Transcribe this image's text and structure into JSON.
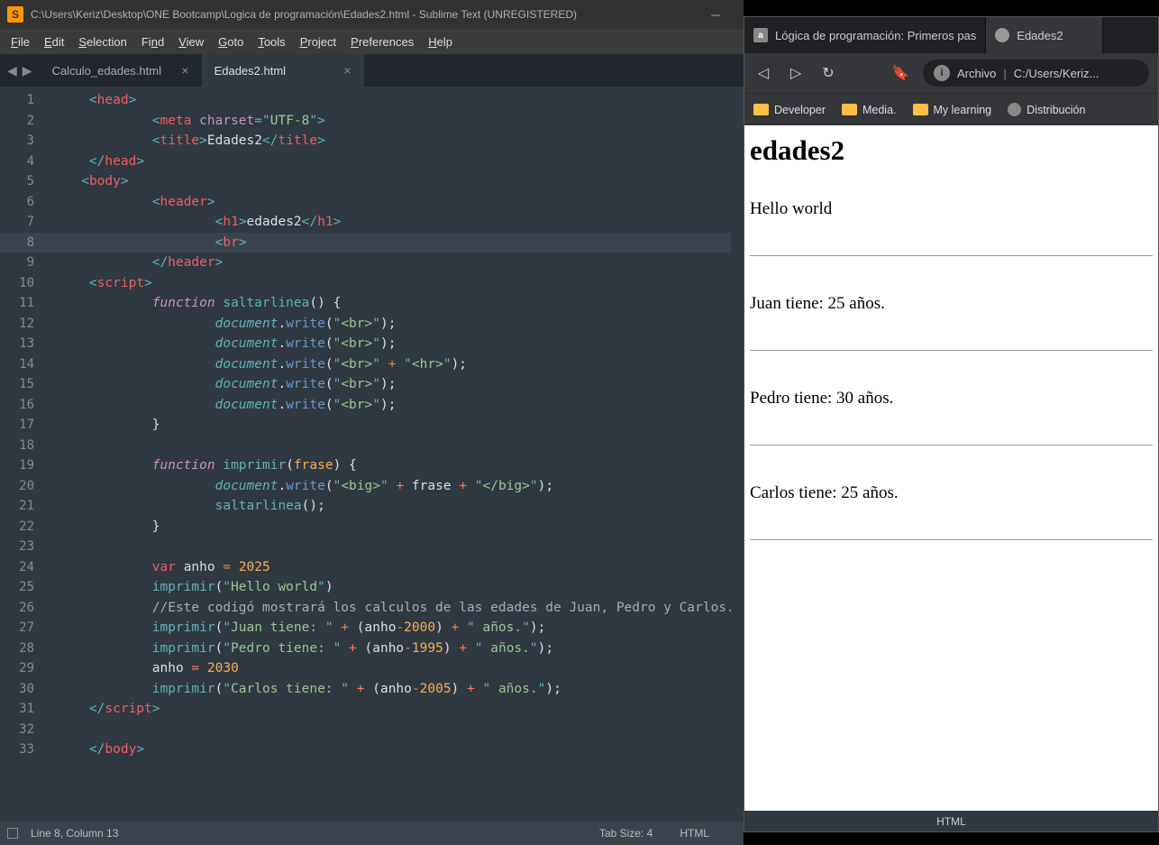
{
  "sublime": {
    "title": "C:\\Users\\Keriz\\Desktop\\ONE Bootcamp\\Logica de programación\\Edades2.html - Sublime Text (UNREGISTERED)",
    "menu": [
      "File",
      "Edit",
      "Selection",
      "Find",
      "View",
      "Goto",
      "Tools",
      "Project",
      "Preferences",
      "Help"
    ],
    "tabs": [
      {
        "label": "Calculo_edades.html",
        "active": false
      },
      {
        "label": "Edades2.html",
        "active": true
      }
    ],
    "status_left": "Line 8, Column 13",
    "status_tab": "Tab Size: 4",
    "status_lang": "HTML",
    "code": {
      "l1": {
        "i": 0,
        "tokens": [
          {
            "c": "p",
            "t": "<"
          },
          {
            "c": "tag",
            "t": "head"
          },
          {
            "c": "p",
            "t": ">"
          }
        ]
      },
      "l2": {
        "i": 2,
        "tokens": [
          {
            "c": "p",
            "t": "<"
          },
          {
            "c": "tag",
            "t": "meta"
          },
          {
            "c": "txt",
            "t": " "
          },
          {
            "c": "attr",
            "t": "charset"
          },
          {
            "c": "p",
            "t": "="
          },
          {
            "c": "p",
            "t": "\""
          },
          {
            "c": "str",
            "t": "UTF-8"
          },
          {
            "c": "p",
            "t": "\""
          },
          {
            "c": "p",
            "t": ">"
          }
        ]
      },
      "l3": {
        "i": 2,
        "tokens": [
          {
            "c": "p",
            "t": "<"
          },
          {
            "c": "tag",
            "t": "title"
          },
          {
            "c": "p",
            "t": ">"
          },
          {
            "c": "txt",
            "t": "Edades2"
          },
          {
            "c": "p",
            "t": "</"
          },
          {
            "c": "tag",
            "t": "title"
          },
          {
            "c": "p",
            "t": ">"
          }
        ]
      },
      "l4": {
        "i": 0,
        "tokens": [
          {
            "c": "p",
            "t": "</"
          },
          {
            "c": "tag",
            "t": "head"
          },
          {
            "c": "p",
            "t": ">"
          }
        ]
      },
      "l5": {
        "i": -1,
        "tokens": [
          {
            "c": "p",
            "t": "<"
          },
          {
            "c": "tag",
            "t": "body"
          },
          {
            "c": "p",
            "t": ">"
          }
        ]
      },
      "l6": {
        "i": 2,
        "tokens": [
          {
            "c": "p",
            "t": "<"
          },
          {
            "c": "tag",
            "t": "header"
          },
          {
            "c": "p",
            "t": ">"
          }
        ]
      },
      "l7": {
        "i": 4,
        "tokens": [
          {
            "c": "p",
            "t": "<"
          },
          {
            "c": "tag",
            "t": "h1"
          },
          {
            "c": "p",
            "t": ">"
          },
          {
            "c": "txt",
            "t": "edades2"
          },
          {
            "c": "p",
            "t": "</"
          },
          {
            "c": "tag",
            "t": "h1"
          },
          {
            "c": "p",
            "t": ">"
          }
        ]
      },
      "l8": {
        "i": 4,
        "tokens": [
          {
            "c": "p",
            "t": "<"
          },
          {
            "c": "tag",
            "t": "br"
          },
          {
            "c": "p",
            "t": ">"
          }
        ],
        "hl": true
      },
      "l9": {
        "i": 2,
        "tokens": [
          {
            "c": "p",
            "t": "</"
          },
          {
            "c": "tag",
            "t": "header"
          },
          {
            "c": "p",
            "t": ">"
          }
        ]
      },
      "l10": {
        "i": 0,
        "tokens": [
          {
            "c": "p",
            "t": "<"
          },
          {
            "c": "tag",
            "t": "script"
          },
          {
            "c": "p",
            "t": ">"
          }
        ]
      },
      "l11": {
        "i": 2,
        "tokens": [
          {
            "c": "kw",
            "t": "function"
          },
          {
            "c": "txt",
            "t": " "
          },
          {
            "c": "fn",
            "t": "saltarlinea"
          },
          {
            "c": "txt",
            "t": "() {"
          }
        ]
      },
      "l12": {
        "i": 4,
        "tokens": [
          {
            "c": "obj",
            "t": "document"
          },
          {
            "c": "txt",
            "t": "."
          },
          {
            "c": "call",
            "t": "write"
          },
          {
            "c": "txt",
            "t": "("
          },
          {
            "c": "p",
            "t": "\""
          },
          {
            "c": "str",
            "t": "<br>"
          },
          {
            "c": "p",
            "t": "\""
          },
          {
            "c": "txt",
            "t": ");"
          }
        ]
      },
      "l13": {
        "i": 4,
        "tokens": [
          {
            "c": "obj",
            "t": "document"
          },
          {
            "c": "txt",
            "t": "."
          },
          {
            "c": "call",
            "t": "write"
          },
          {
            "c": "txt",
            "t": "("
          },
          {
            "c": "p",
            "t": "\""
          },
          {
            "c": "str",
            "t": "<br>"
          },
          {
            "c": "p",
            "t": "\""
          },
          {
            "c": "txt",
            "t": ");"
          }
        ]
      },
      "l14": {
        "i": 4,
        "tokens": [
          {
            "c": "obj",
            "t": "document"
          },
          {
            "c": "txt",
            "t": "."
          },
          {
            "c": "call",
            "t": "write"
          },
          {
            "c": "txt",
            "t": "("
          },
          {
            "c": "p",
            "t": "\""
          },
          {
            "c": "str",
            "t": "<br>"
          },
          {
            "c": "p",
            "t": "\""
          },
          {
            "c": "txt",
            "t": " "
          },
          {
            "c": "op",
            "t": "+"
          },
          {
            "c": "txt",
            "t": " "
          },
          {
            "c": "p",
            "t": "\""
          },
          {
            "c": "str",
            "t": "<hr>"
          },
          {
            "c": "p",
            "t": "\""
          },
          {
            "c": "txt",
            "t": ");"
          }
        ]
      },
      "l15": {
        "i": 4,
        "tokens": [
          {
            "c": "obj",
            "t": "document"
          },
          {
            "c": "txt",
            "t": "."
          },
          {
            "c": "call",
            "t": "write"
          },
          {
            "c": "txt",
            "t": "("
          },
          {
            "c": "p",
            "t": "\""
          },
          {
            "c": "str",
            "t": "<br>"
          },
          {
            "c": "p",
            "t": "\""
          },
          {
            "c": "txt",
            "t": ");"
          }
        ]
      },
      "l16": {
        "i": 4,
        "tokens": [
          {
            "c": "obj",
            "t": "document"
          },
          {
            "c": "txt",
            "t": "."
          },
          {
            "c": "call",
            "t": "write"
          },
          {
            "c": "txt",
            "t": "("
          },
          {
            "c": "p",
            "t": "\""
          },
          {
            "c": "str",
            "t": "<br>"
          },
          {
            "c": "p",
            "t": "\""
          },
          {
            "c": "txt",
            "t": ");"
          }
        ]
      },
      "l17": {
        "i": 2,
        "tokens": [
          {
            "c": "txt",
            "t": "}"
          }
        ]
      },
      "l18": {
        "i": 0,
        "tokens": []
      },
      "l19": {
        "i": 2,
        "tokens": [
          {
            "c": "kw",
            "t": "function"
          },
          {
            "c": "txt",
            "t": " "
          },
          {
            "c": "fn",
            "t": "imprimir"
          },
          {
            "c": "txt",
            "t": "("
          },
          {
            "c": "par",
            "t": "frase"
          },
          {
            "c": "txt",
            "t": ") {"
          }
        ]
      },
      "l20": {
        "i": 4,
        "tokens": [
          {
            "c": "obj",
            "t": "document"
          },
          {
            "c": "txt",
            "t": "."
          },
          {
            "c": "call",
            "t": "write"
          },
          {
            "c": "txt",
            "t": "("
          },
          {
            "c": "p",
            "t": "\""
          },
          {
            "c": "str",
            "t": "<big>"
          },
          {
            "c": "p",
            "t": "\""
          },
          {
            "c": "txt",
            "t": " "
          },
          {
            "c": "op",
            "t": "+"
          },
          {
            "c": "txt",
            "t": " frase "
          },
          {
            "c": "op",
            "t": "+"
          },
          {
            "c": "txt",
            "t": " "
          },
          {
            "c": "p",
            "t": "\""
          },
          {
            "c": "str",
            "t": "</big>"
          },
          {
            "c": "p",
            "t": "\""
          },
          {
            "c": "txt",
            "t": ");"
          }
        ]
      },
      "l21": {
        "i": 4,
        "tokens": [
          {
            "c": "fn",
            "t": "saltarlinea"
          },
          {
            "c": "txt",
            "t": "();"
          }
        ]
      },
      "l22": {
        "i": 2,
        "tokens": [
          {
            "c": "txt",
            "t": "}"
          }
        ]
      },
      "l23": {
        "i": 0,
        "tokens": []
      },
      "l24": {
        "i": 2,
        "tokens": [
          {
            "c": "tag",
            "t": "var"
          },
          {
            "c": "txt",
            "t": " anho "
          },
          {
            "c": "op",
            "t": "="
          },
          {
            "c": "txt",
            "t": " "
          },
          {
            "c": "num",
            "t": "2025"
          }
        ]
      },
      "l25": {
        "i": 2,
        "tokens": [
          {
            "c": "fn",
            "t": "imprimir"
          },
          {
            "c": "txt",
            "t": "("
          },
          {
            "c": "p",
            "t": "\""
          },
          {
            "c": "str",
            "t": "Hello world"
          },
          {
            "c": "p",
            "t": "\""
          },
          {
            "c": "txt",
            "t": ")"
          }
        ]
      },
      "l26": {
        "i": 2,
        "tokens": [
          {
            "c": "cmt",
            "t": "//Este codigó mostrará los calculos de las edades de Juan, Pedro y Carlos."
          }
        ]
      },
      "l27": {
        "i": 2,
        "tokens": [
          {
            "c": "fn",
            "t": "imprimir"
          },
          {
            "c": "txt",
            "t": "("
          },
          {
            "c": "p",
            "t": "\""
          },
          {
            "c": "str",
            "t": "Juan tiene: "
          },
          {
            "c": "p",
            "t": "\""
          },
          {
            "c": "txt",
            "t": " "
          },
          {
            "c": "op",
            "t": "+"
          },
          {
            "c": "txt",
            "t": " (anho"
          },
          {
            "c": "op",
            "t": "-"
          },
          {
            "c": "num",
            "t": "2000"
          },
          {
            "c": "txt",
            "t": ") "
          },
          {
            "c": "op",
            "t": "+"
          },
          {
            "c": "txt",
            "t": " "
          },
          {
            "c": "p",
            "t": "\""
          },
          {
            "c": "str",
            "t": " años."
          },
          {
            "c": "p",
            "t": "\""
          },
          {
            "c": "txt",
            "t": ");"
          }
        ]
      },
      "l28": {
        "i": 2,
        "tokens": [
          {
            "c": "fn",
            "t": "imprimir"
          },
          {
            "c": "txt",
            "t": "("
          },
          {
            "c": "p",
            "t": "\""
          },
          {
            "c": "str",
            "t": "Pedro tiene: "
          },
          {
            "c": "p",
            "t": "\""
          },
          {
            "c": "txt",
            "t": " "
          },
          {
            "c": "op",
            "t": "+"
          },
          {
            "c": "txt",
            "t": " (anho"
          },
          {
            "c": "op",
            "t": "-"
          },
          {
            "c": "num",
            "t": "1995"
          },
          {
            "c": "txt",
            "t": ") "
          },
          {
            "c": "op",
            "t": "+"
          },
          {
            "c": "txt",
            "t": " "
          },
          {
            "c": "p",
            "t": "\""
          },
          {
            "c": "str",
            "t": " años."
          },
          {
            "c": "p",
            "t": "\""
          },
          {
            "c": "txt",
            "t": ");"
          }
        ]
      },
      "l29": {
        "i": 2,
        "tokens": [
          {
            "c": "txt",
            "t": "anho "
          },
          {
            "c": "op",
            "t": "="
          },
          {
            "c": "txt",
            "t": " "
          },
          {
            "c": "num",
            "t": "2030"
          }
        ]
      },
      "l30": {
        "i": 2,
        "tokens": [
          {
            "c": "fn",
            "t": "imprimir"
          },
          {
            "c": "txt",
            "t": "("
          },
          {
            "c": "p",
            "t": "\""
          },
          {
            "c": "str",
            "t": "Carlos tiene: "
          },
          {
            "c": "p",
            "t": "\""
          },
          {
            "c": "txt",
            "t": " "
          },
          {
            "c": "op",
            "t": "+"
          },
          {
            "c": "txt",
            "t": " (anho"
          },
          {
            "c": "op",
            "t": "-"
          },
          {
            "c": "num",
            "t": "2005"
          },
          {
            "c": "txt",
            "t": ") "
          },
          {
            "c": "op",
            "t": "+"
          },
          {
            "c": "txt",
            "t": " "
          },
          {
            "c": "p",
            "t": "\""
          },
          {
            "c": "str",
            "t": " años."
          },
          {
            "c": "p",
            "t": "\""
          },
          {
            "c": "txt",
            "t": ");"
          }
        ]
      },
      "l31": {
        "i": 0,
        "tokens": [
          {
            "c": "p",
            "t": "</"
          },
          {
            "c": "tag",
            "t": "script"
          },
          {
            "c": "p",
            "t": ">"
          }
        ]
      },
      "l32": {
        "i": 0,
        "tokens": []
      },
      "l33": {
        "i": 0,
        "tokens": [
          {
            "c": "p",
            "t": "</"
          },
          {
            "c": "tag",
            "t": "body"
          },
          {
            "c": "p",
            "t": ">"
          }
        ]
      }
    }
  },
  "browser": {
    "tabs": [
      {
        "label": "Lógica de programación: Primeros pas",
        "active": false,
        "icon": "a"
      },
      {
        "label": "Edades2",
        "active": true,
        "icon": "globe"
      }
    ],
    "addr_prefix": "Archivo",
    "addr_path": "C:/Users/Keriz...",
    "bookmarks": [
      {
        "label": "Developer",
        "icon": "folder"
      },
      {
        "label": "Media.",
        "icon": "folder"
      },
      {
        "label": "My learning",
        "icon": "folder"
      },
      {
        "label": "Distribución",
        "icon": "globe"
      }
    ],
    "page": {
      "h1": "edades2",
      "lines": [
        "Hello world",
        "Juan tiene: 25 años.",
        "Pedro tiene: 30 años.",
        "Carlos tiene: 25 años."
      ]
    },
    "status": "HTML"
  }
}
